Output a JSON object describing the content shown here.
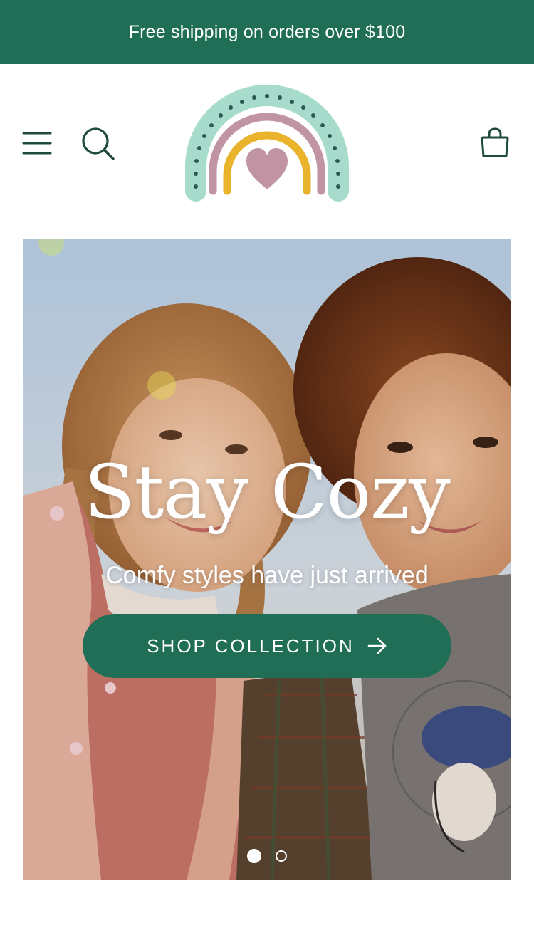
{
  "announcement": {
    "text": "Free shipping on orders over $100"
  },
  "header": {
    "icons": {
      "menu": "hamburger-menu-icon",
      "search": "search-icon",
      "cart": "shopping-bag-icon",
      "logo": "rainbow-heart-logo"
    }
  },
  "hero": {
    "title": "Stay Cozy",
    "subtitle": "Comfy styles have just arrived",
    "cta_label": "SHOP COLLECTION",
    "cta_icon": "arrow-right-icon",
    "slides": {
      "current": 1,
      "total": 2
    }
  },
  "colors": {
    "brand_green": "#1f6e55",
    "logo_mint": "#a7dccd",
    "logo_mauve": "#c194a3",
    "logo_yellow": "#e9b32c",
    "logo_dots": "#2c5a4e"
  }
}
